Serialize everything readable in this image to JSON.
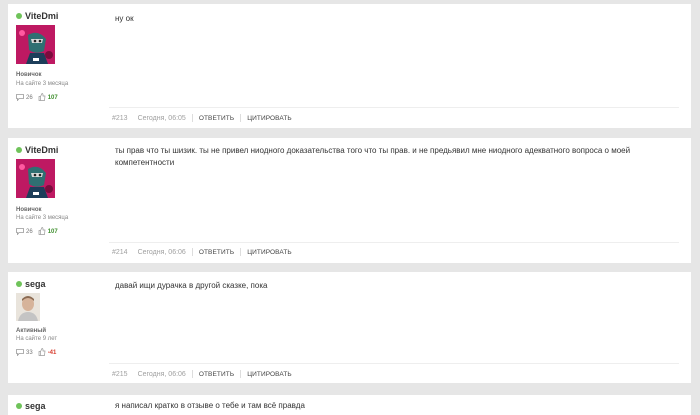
{
  "posts": [
    {
      "author": "ViteDmi",
      "rank": "Новичок",
      "since": "На сайте 3 месяца",
      "comments": "26",
      "reputation": "107",
      "reputation_sign": "positive",
      "text": "ну ок",
      "number": "#213",
      "date": "Сегодня, 06:05",
      "reply_label": "ОТВЕТИТЬ",
      "quote_label": "ЦИТИРОВАТЬ"
    },
    {
      "author": "ViteDmi",
      "rank": "Новичок",
      "since": "На сайте 3 месяца",
      "comments": "26",
      "reputation": "107",
      "reputation_sign": "positive",
      "text": "ты прав что ты шизик. ты не привел ниодного доказательства того что ты прав. и не предьявил мне ниодного адекватного вопроса о моей компетентности",
      "number": "#214",
      "date": "Сегодня, 06:06",
      "reply_label": "ОТВЕТИТЬ",
      "quote_label": "ЦИТИРОВАТЬ"
    },
    {
      "author": "sega",
      "rank": "Активный",
      "since": "На сайте 9 лет",
      "comments": "33",
      "reputation": "-41",
      "reputation_sign": "negative",
      "text": "давай ищи дурачка в другой сказке, пока",
      "number": "#215",
      "date": "Сегодня, 06:06",
      "reply_label": "ОТВЕТИТЬ",
      "quote_label": "ЦИТИРОВАТЬ"
    },
    {
      "author": "sega",
      "text": "я написал кратко в отзыве о тебе и там всё правда"
    }
  ],
  "colors": {
    "online": "#6fc35a",
    "reputation_positive": "#3f8f2e",
    "reputation_negative": "#d63b2c",
    "page_background": "#e6e6e6"
  },
  "icons": {
    "comments": "speech-bubble-icon",
    "reputation": "thumb-up-icon",
    "status": "online-dot-icon"
  }
}
